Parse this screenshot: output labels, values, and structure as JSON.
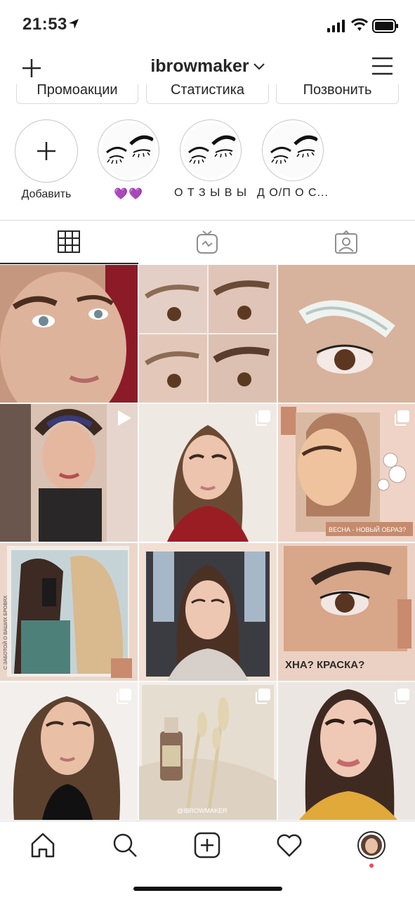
{
  "status_bar": {
    "time": "21:53"
  },
  "header": {
    "username": "ibrowmaker",
    "icons": [
      "add-icon",
      "chevron-down-icon",
      "menu-icon"
    ]
  },
  "actions": [
    {
      "label": "Промоакции"
    },
    {
      "label": "Статистика"
    },
    {
      "label": "Позвонить"
    }
  ],
  "highlights": [
    {
      "label": "Добавить",
      "icon": "plus-icon"
    },
    {
      "label": "💜💜",
      "icon": "brow-cover"
    },
    {
      "label": "О Т З Ы В Ы",
      "icon": "brow-cover"
    },
    {
      "label": "Д О/П О С...",
      "icon": "brow-cover"
    }
  ],
  "tabs": [
    {
      "name": "grid",
      "icon": "grid-icon",
      "active": true
    },
    {
      "name": "igtv",
      "icon": "igtv-icon",
      "active": false
    },
    {
      "name": "tagged",
      "icon": "tagged-icon",
      "active": false
    }
  ],
  "posts": [
    {
      "kind": "photo",
      "overlay": ""
    },
    {
      "kind": "photo",
      "overlay": ""
    },
    {
      "kind": "photo",
      "overlay": ""
    },
    {
      "kind": "video",
      "overlay": ""
    },
    {
      "kind": "carousel",
      "overlay": ""
    },
    {
      "kind": "carousel",
      "overlay": "ВЕСНА - НОВЫЙ ОБРАЗ?"
    },
    {
      "kind": "photo",
      "overlay": "С ЗАБОТОЙ О ВАШИХ БРОВЯХ"
    },
    {
      "kind": "photo",
      "overlay": ""
    },
    {
      "kind": "photo",
      "overlay": "ХНА? КРАСКА?"
    },
    {
      "kind": "carousel",
      "overlay": ""
    },
    {
      "kind": "carousel",
      "overlay": "@IBROWMAKER"
    },
    {
      "kind": "carousel",
      "overlay": ""
    }
  ],
  "tab_bar": {
    "icons": [
      "home-icon",
      "search-icon",
      "new-post-icon",
      "activity-icon",
      "profile-avatar"
    ]
  },
  "colors": {
    "text": "#262626",
    "border": "#dbdbdb",
    "notification_dot": "#ed4956",
    "tile_peach": "#e9c7b6",
    "tile_skin": "#d7a98c"
  }
}
